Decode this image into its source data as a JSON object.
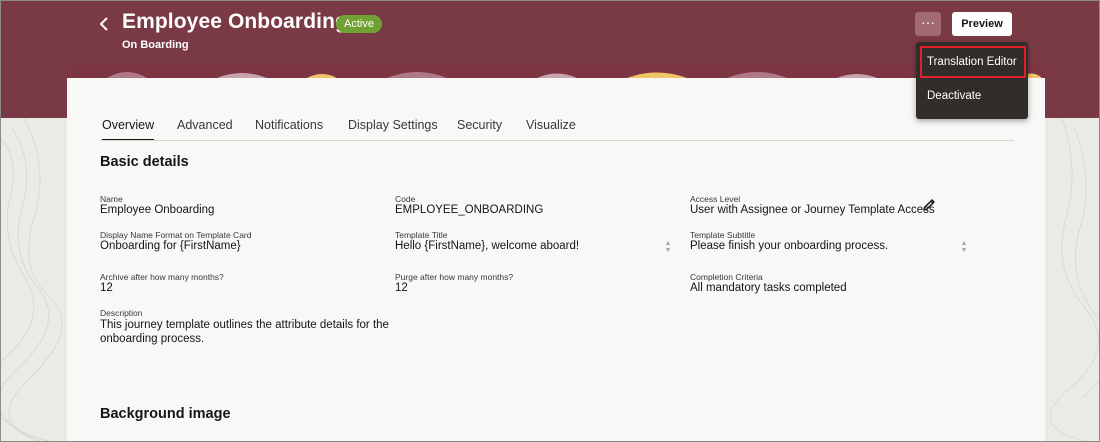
{
  "header": {
    "back_icon": "chevron-left-icon",
    "title": "Employee Onboarding",
    "status": "Active",
    "subtitle": "On Boarding",
    "more_icon": "ellipsis-icon",
    "more_label": "···",
    "preview_label": "Preview",
    "colors": {
      "header_bg": "#7a3a45",
      "badge_bg": "#6fa233"
    }
  },
  "menu": {
    "items": [
      {
        "label": "Translation Editor",
        "highlighted": true
      },
      {
        "label": "Deactivate"
      }
    ]
  },
  "tabs": [
    {
      "label": "Overview",
      "active": true
    },
    {
      "label": "Advanced"
    },
    {
      "label": "Notifications"
    },
    {
      "label": "Display Settings"
    },
    {
      "label": "Security"
    },
    {
      "label": "Visualize"
    }
  ],
  "basic_details": {
    "title": "Basic details",
    "fields": {
      "name": {
        "label": "Name",
        "value": "Employee Onboarding"
      },
      "code": {
        "label": "Code",
        "value": "EMPLOYEE_ONBOARDING"
      },
      "access_level": {
        "label": "Access Level",
        "value": "User with Assignee or Journey Template Access"
      },
      "display_name_format": {
        "label": "Display Name Format on Template Card",
        "value": "Onboarding for {FirstName}"
      },
      "template_title": {
        "label": "Template Title",
        "value": "Hello {FirstName}, welcome aboard!"
      },
      "template_subtitle": {
        "label": "Template Subtitle",
        "value": "Please finish your onboarding process."
      },
      "archive_after": {
        "label": "Archive after how many months?",
        "value": "12"
      },
      "purge_after": {
        "label": "Purge after how many months?",
        "value": "12"
      },
      "completion_criteria": {
        "label": "Completion Criteria",
        "value": "All mandatory tasks completed"
      },
      "description": {
        "label": "Description",
        "value": "This journey template outlines the attribute details for the onboarding process."
      }
    },
    "edit_icon": "pencil-icon"
  },
  "background_image": {
    "title": "Background image"
  }
}
